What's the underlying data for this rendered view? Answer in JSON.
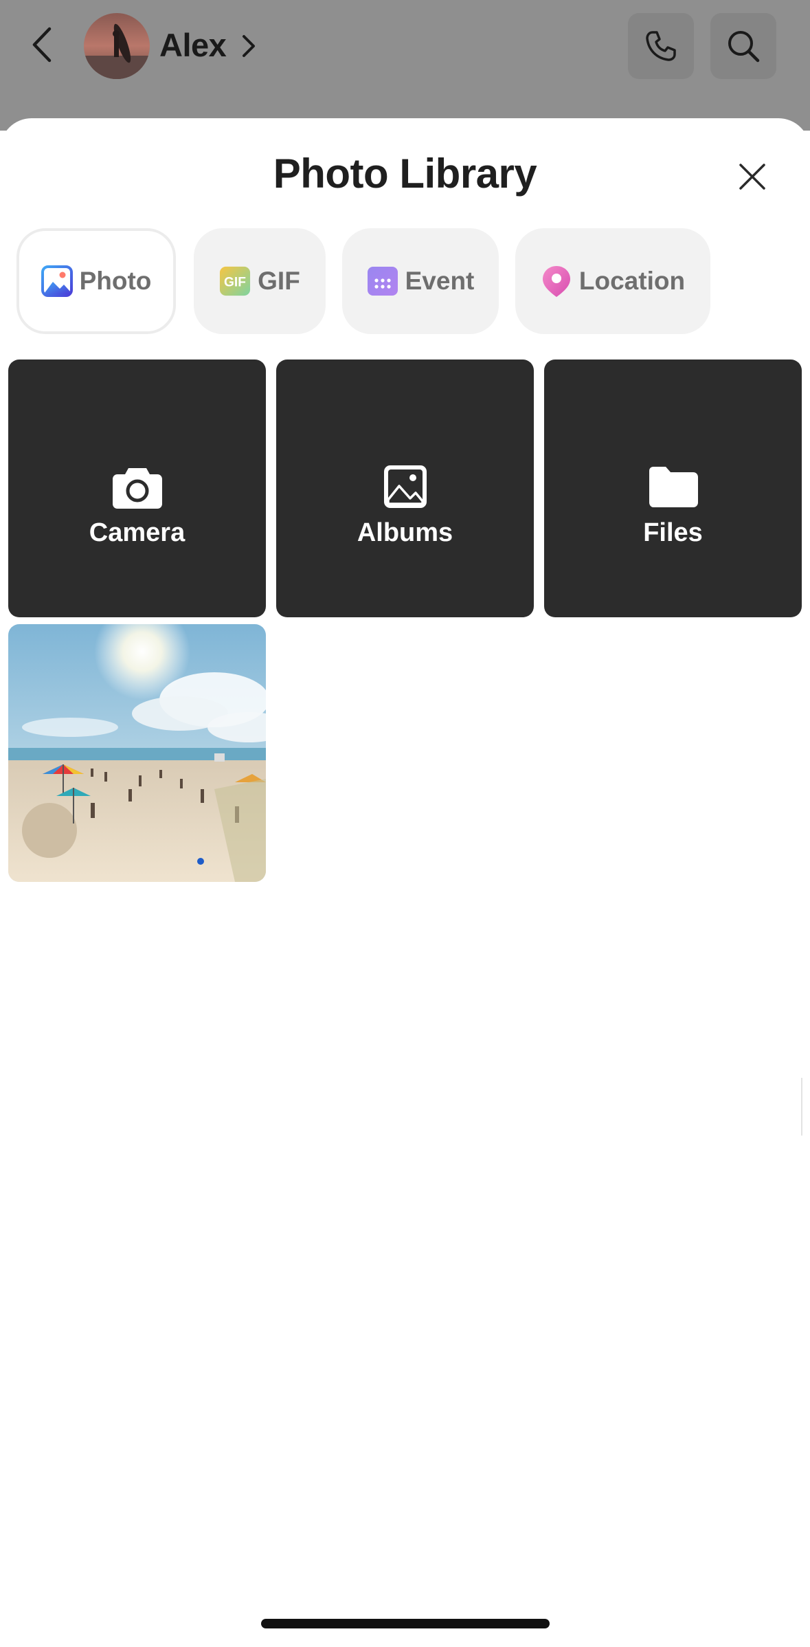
{
  "chat_header": {
    "contact_name": "Alex",
    "icons": {
      "back": "chevron-left-icon",
      "contact_details": "chevron-right-icon",
      "call": "phone-icon",
      "search": "search-icon"
    }
  },
  "sheet": {
    "title": "Photo Library",
    "close_icon": "close-icon",
    "tabs": [
      {
        "label": "Photo",
        "icon": "photo-icon",
        "active": true
      },
      {
        "label": "GIF",
        "icon": "gif-icon",
        "active": false
      },
      {
        "label": "Event",
        "icon": "calendar-icon",
        "active": false
      },
      {
        "label": "Location",
        "icon": "location-pin-icon",
        "active": false
      }
    ],
    "actions": [
      {
        "label": "Camera",
        "icon": "camera-icon"
      },
      {
        "label": "Albums",
        "icon": "image-icon"
      },
      {
        "label": "Files",
        "icon": "folder-icon"
      }
    ],
    "photos": [
      {
        "subject": "beach scene with umbrellas"
      }
    ]
  },
  "colors": {
    "tile_background": "#2c2c2c",
    "tab_background": "#f2f2f2",
    "overlay": "#8f8f8f"
  }
}
